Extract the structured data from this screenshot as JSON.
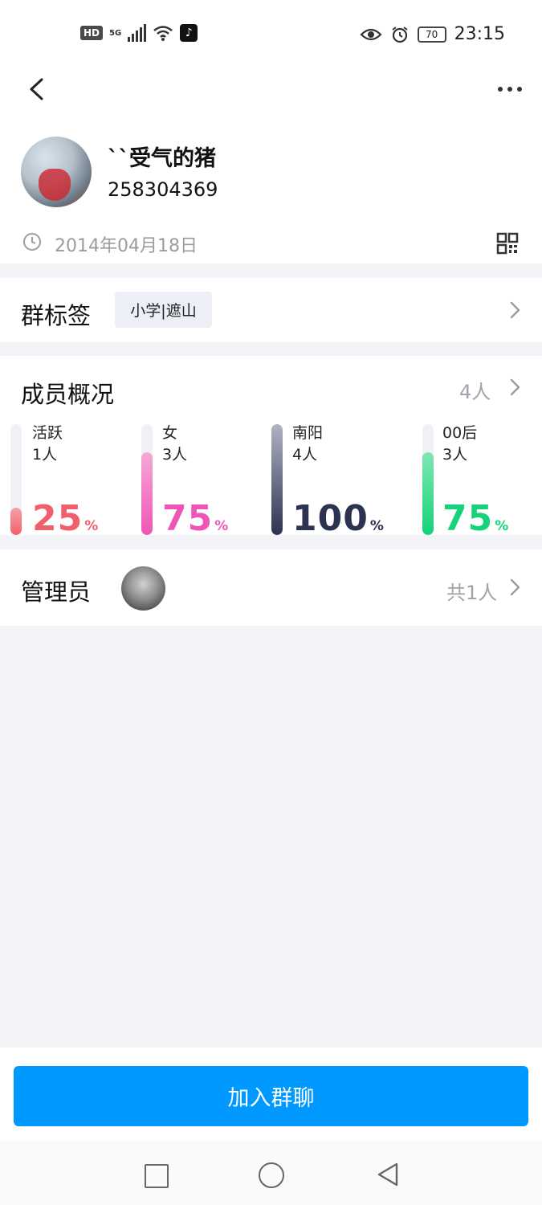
{
  "status_bar": {
    "network": "HD",
    "signal": "5G",
    "battery": "70",
    "time": "23:15"
  },
  "group": {
    "name": "``受气的猪",
    "id": "258304369",
    "created_date": "2014年04月18日"
  },
  "tags": {
    "title": "群标签",
    "chip": "小学|遮山"
  },
  "members": {
    "title": "成员概况",
    "count": "4人",
    "stats": [
      {
        "label": "活跃",
        "count": "1人",
        "value": "25",
        "unit": "%",
        "percent": 25,
        "color": "#f0606c",
        "fill_top": "#f8a0a8"
      },
      {
        "label": "女",
        "count": "3人",
        "value": "75",
        "unit": "%",
        "percent": 75,
        "color": "#ef55b6",
        "fill_top": "#f6a8d6"
      },
      {
        "label": "南阳",
        "count": "4人",
        "value": "100",
        "unit": "%",
        "percent": 100,
        "color": "#2b3350",
        "fill_top": "#b0b3c2"
      },
      {
        "label": "00后",
        "count": "3人",
        "value": "75",
        "unit": "%",
        "percent": 75,
        "color": "#16d27a",
        "fill_top": "#7ee7b2"
      }
    ]
  },
  "admin": {
    "title": "管理员",
    "count": "共1人"
  },
  "actions": {
    "join": "加入群聊"
  },
  "icons": {
    "back": "back-icon",
    "more": "more-icon",
    "clock": "clock-icon",
    "qr": "qr-code-icon",
    "chevron": "chevron-right-icon"
  }
}
